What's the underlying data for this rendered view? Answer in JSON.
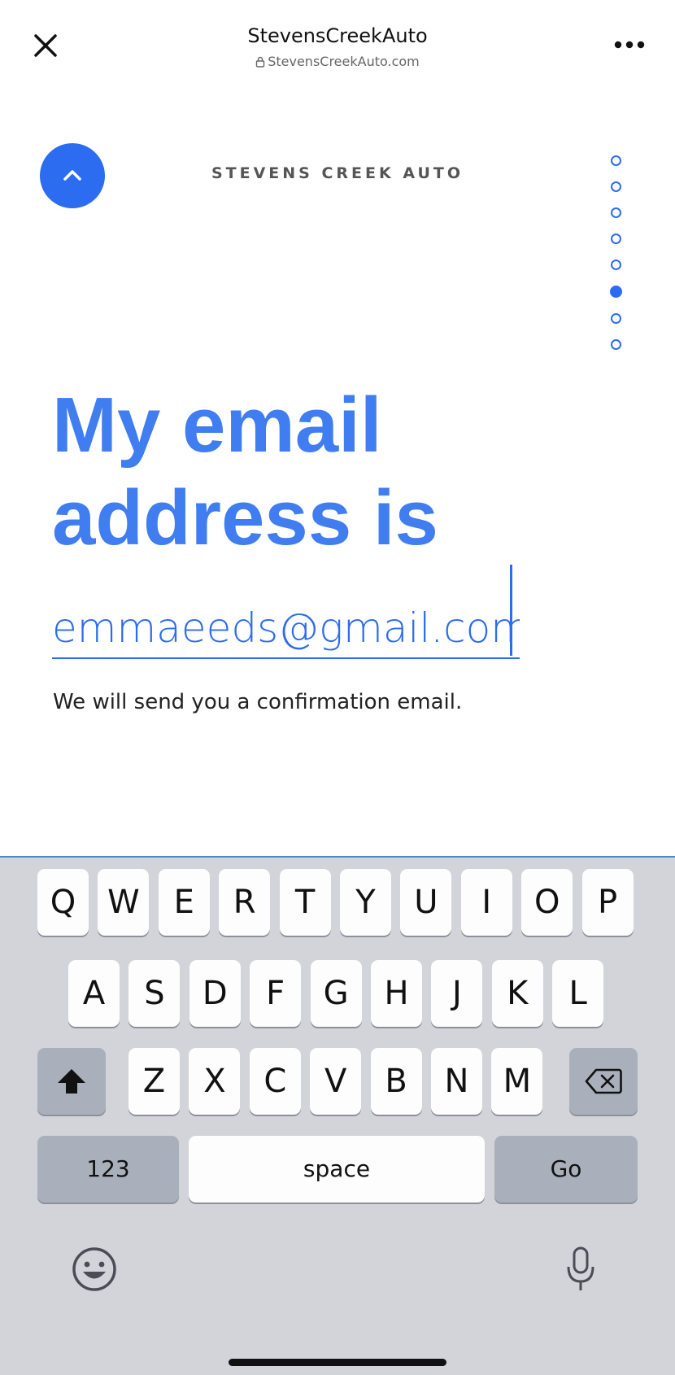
{
  "browser_header": {
    "title": "StevensCreekAuto",
    "url": "StevensCreekAuto.com",
    "close_icon": "close-icon",
    "lock_icon": "lock-icon",
    "more_icon": "more-horizontal-icon"
  },
  "form": {
    "brand": "STEVENS CREEK AUTO",
    "up_icon": "chevron-up-icon",
    "question": "My email address is",
    "email_value": "emmaeeds@gmail.com",
    "hint": "We will send you a confirmation email.",
    "progress": {
      "total_steps": 8,
      "current_step": 6
    }
  },
  "colors": {
    "accent": "#2c6cf0",
    "question_text": "#3f7df0",
    "keyboard_bg": "#d2d4da",
    "key_bg": "#fdfdfe",
    "key_gray": "#aab0bb"
  },
  "keyboard": {
    "row1": [
      "Q",
      "W",
      "E",
      "R",
      "T",
      "Y",
      "U",
      "I",
      "O",
      "P"
    ],
    "row2": [
      "A",
      "S",
      "D",
      "F",
      "G",
      "H",
      "J",
      "K",
      "L"
    ],
    "row3": [
      "Z",
      "X",
      "C",
      "V",
      "B",
      "N",
      "M"
    ],
    "shift_icon": "shift-icon",
    "delete_icon": "backspace-icon",
    "numbers_label": "123",
    "space_label": "space",
    "go_label": "Go",
    "emoji_icon": "emoji-icon",
    "mic_icon": "microphone-icon"
  }
}
